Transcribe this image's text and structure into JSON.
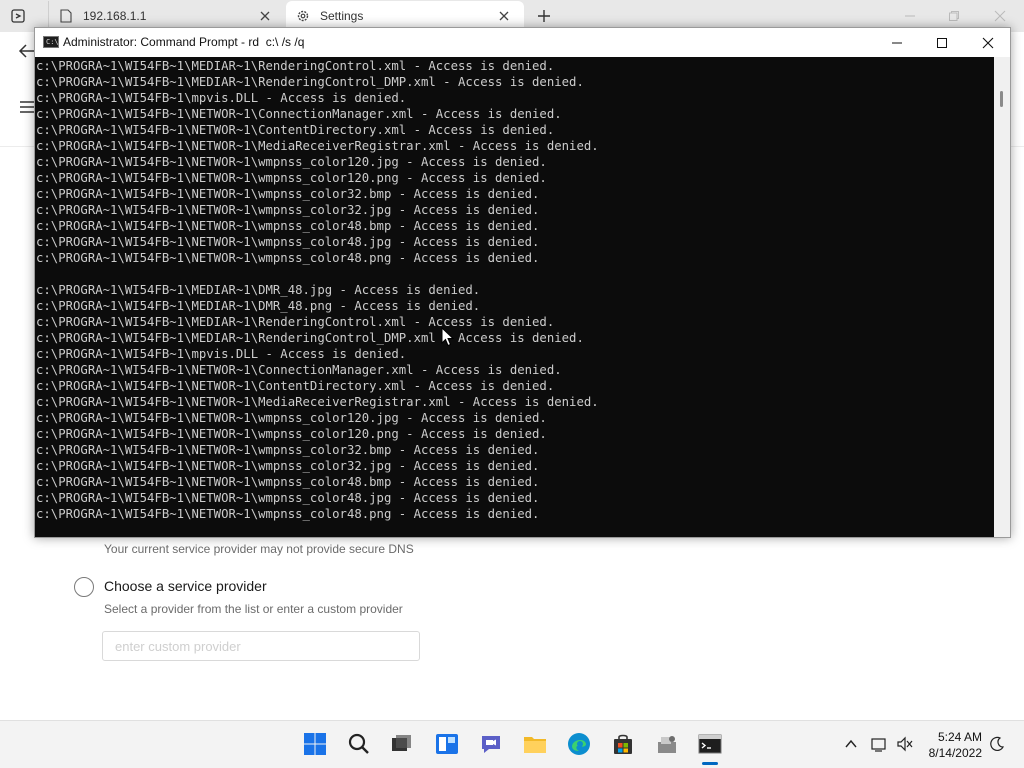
{
  "browser": {
    "tabs": [
      {
        "label": "192.168.1.1",
        "icon": "page-icon"
      },
      {
        "label": "Settings",
        "icon": "gear-icon"
      }
    ]
  },
  "settings": {
    "dns_warning": "Your current service provider may not provide secure DNS",
    "choose_provider_label": "Choose a service provider",
    "choose_provider_desc": "Select a provider from the list or enter a custom provider",
    "custom_provider_placeholder": "enter custom provider"
  },
  "cmd": {
    "title": "Administrator: Command Prompt - rd  c:\\ /s /q",
    "lines": [
      "c:\\PROGRA~1\\WI54FB~1\\MEDIAR~1\\RenderingControl.xml - Access is denied.",
      "c:\\PROGRA~1\\WI54FB~1\\MEDIAR~1\\RenderingControl_DMP.xml - Access is denied.",
      "c:\\PROGRA~1\\WI54FB~1\\mpvis.DLL - Access is denied.",
      "c:\\PROGRA~1\\WI54FB~1\\NETWOR~1\\ConnectionManager.xml - Access is denied.",
      "c:\\PROGRA~1\\WI54FB~1\\NETWOR~1\\ContentDirectory.xml - Access is denied.",
      "c:\\PROGRA~1\\WI54FB~1\\NETWOR~1\\MediaReceiverRegistrar.xml - Access is denied.",
      "c:\\PROGRA~1\\WI54FB~1\\NETWOR~1\\wmpnss_color120.jpg - Access is denied.",
      "c:\\PROGRA~1\\WI54FB~1\\NETWOR~1\\wmpnss_color120.png - Access is denied.",
      "c:\\PROGRA~1\\WI54FB~1\\NETWOR~1\\wmpnss_color32.bmp - Access is denied.",
      "c:\\PROGRA~1\\WI54FB~1\\NETWOR~1\\wmpnss_color32.jpg - Access is denied.",
      "c:\\PROGRA~1\\WI54FB~1\\NETWOR~1\\wmpnss_color48.bmp - Access is denied.",
      "c:\\PROGRA~1\\WI54FB~1\\NETWOR~1\\wmpnss_color48.jpg - Access is denied.",
      "c:\\PROGRA~1\\WI54FB~1\\NETWOR~1\\wmpnss_color48.png - Access is denied.",
      "",
      "c:\\PROGRA~1\\WI54FB~1\\MEDIAR~1\\DMR_48.jpg - Access is denied.",
      "c:\\PROGRA~1\\WI54FB~1\\MEDIAR~1\\DMR_48.png - Access is denied.",
      "c:\\PROGRA~1\\WI54FB~1\\MEDIAR~1\\RenderingControl.xml - Access is denied.",
      "c:\\PROGRA~1\\WI54FB~1\\MEDIAR~1\\RenderingControl_DMP.xml - Access is denied.",
      "c:\\PROGRA~1\\WI54FB~1\\mpvis.DLL - Access is denied.",
      "c:\\PROGRA~1\\WI54FB~1\\NETWOR~1\\ConnectionManager.xml - Access is denied.",
      "c:\\PROGRA~1\\WI54FB~1\\NETWOR~1\\ContentDirectory.xml - Access is denied.",
      "c:\\PROGRA~1\\WI54FB~1\\NETWOR~1\\MediaReceiverRegistrar.xml - Access is denied.",
      "c:\\PROGRA~1\\WI54FB~1\\NETWOR~1\\wmpnss_color120.jpg - Access is denied.",
      "c:\\PROGRA~1\\WI54FB~1\\NETWOR~1\\wmpnss_color120.png - Access is denied.",
      "c:\\PROGRA~1\\WI54FB~1\\NETWOR~1\\wmpnss_color32.bmp - Access is denied.",
      "c:\\PROGRA~1\\WI54FB~1\\NETWOR~1\\wmpnss_color32.jpg - Access is denied.",
      "c:\\PROGRA~1\\WI54FB~1\\NETWOR~1\\wmpnss_color48.bmp - Access is denied.",
      "c:\\PROGRA~1\\WI54FB~1\\NETWOR~1\\wmpnss_color48.jpg - Access is denied.",
      "c:\\PROGRA~1\\WI54FB~1\\NETWOR~1\\wmpnss_color48.png - Access is denied."
    ]
  },
  "taskbar": {
    "apps": [
      {
        "name": "start-icon"
      },
      {
        "name": "search-icon"
      },
      {
        "name": "task-view-icon"
      },
      {
        "name": "widgets-icon"
      },
      {
        "name": "chat-icon"
      },
      {
        "name": "file-explorer-icon"
      },
      {
        "name": "edge-icon"
      },
      {
        "name": "store-icon"
      },
      {
        "name": "app-icon"
      },
      {
        "name": "command-prompt-icon"
      }
    ],
    "time": "5:24 AM",
    "date": "8/14/2022"
  },
  "colors": {
    "console_bg": "#0c0c0c",
    "console_text": "#cccccc",
    "accent": "#0067c0"
  }
}
